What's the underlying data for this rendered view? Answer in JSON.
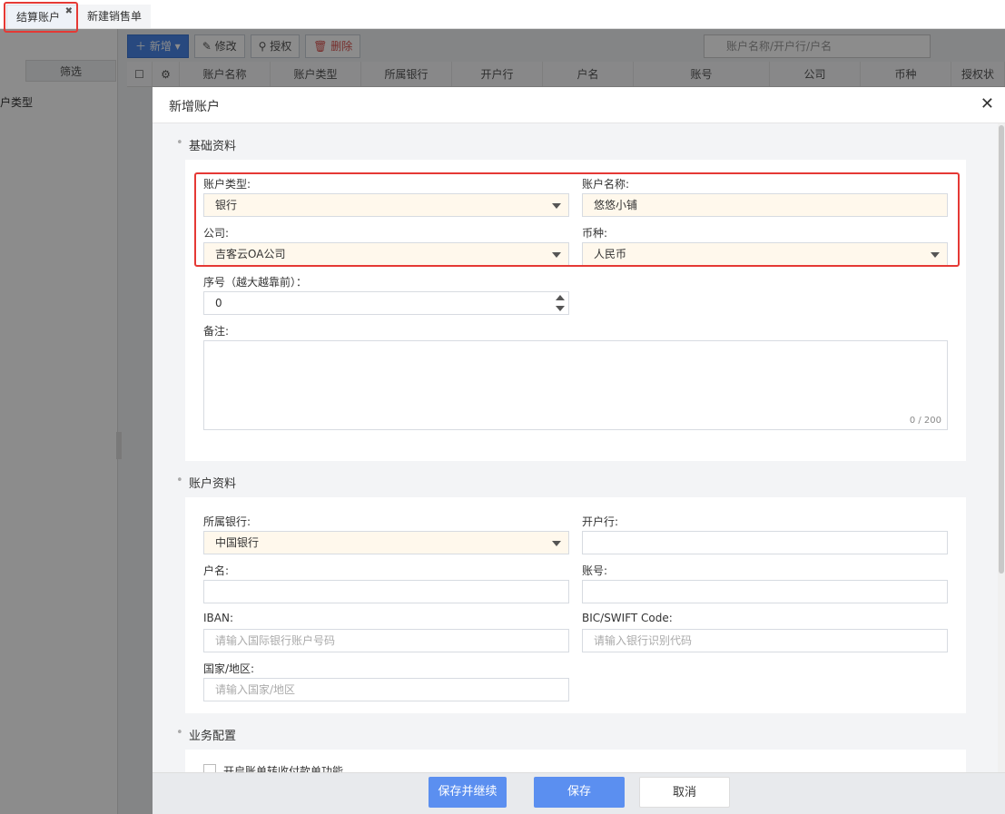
{
  "tabs": [
    {
      "label": "结算账户",
      "active": true
    },
    {
      "label": "新建销售单",
      "active": false
    }
  ],
  "background": {
    "filter_label": "筛选",
    "left_label": "户类型",
    "toolbar": {
      "add": "新增",
      "edit": "修改",
      "auth": "授权",
      "delete": "删除"
    },
    "search_placeholder": "账户名称/开户行/户名",
    "columns": [
      "账户名称",
      "账户类型",
      "所属银行",
      "开户行",
      "户名",
      "账号",
      "公司",
      "币种",
      "授权状"
    ]
  },
  "modal": {
    "title": "新增账户",
    "sections": {
      "basic": "基础资料",
      "account": "账户资料",
      "business": "业务配置"
    },
    "fields": {
      "account_type": {
        "label": "账户类型:",
        "value": "银行"
      },
      "account_name": {
        "label": "账户名称:",
        "value": "悠悠小铺"
      },
      "company": {
        "label": "公司:",
        "value": "吉客云OA公司"
      },
      "currency": {
        "label": "币种:",
        "value": "人民币"
      },
      "sequence": {
        "label": "序号（越大越靠前）：",
        "value": "0"
      },
      "remark": {
        "label": "备注:",
        "counter": "0 / 200"
      },
      "bank": {
        "label": "所属银行:",
        "value": "中国银行"
      },
      "branch": {
        "label": "开户行:",
        "value": ""
      },
      "holder": {
        "label": "户名:",
        "value": ""
      },
      "account_no": {
        "label": "账号:",
        "value": ""
      },
      "iban": {
        "label": "IBAN:",
        "placeholder": "请输入国际银行账户号码"
      },
      "swift": {
        "label": "BIC/SWIFT Code:",
        "placeholder": "请输入银行识别代码"
      },
      "country": {
        "label": "国家/地区:",
        "placeholder": "请输入国家/地区"
      },
      "business_option": "开启账单转收付款单功能"
    },
    "buttons": {
      "save_continue": "保存并继续",
      "save": "保存",
      "cancel": "取消"
    }
  },
  "colors": {
    "primary": "#5b8ff0",
    "highlight": "#e53935",
    "required_bg": "#fff8ec"
  }
}
